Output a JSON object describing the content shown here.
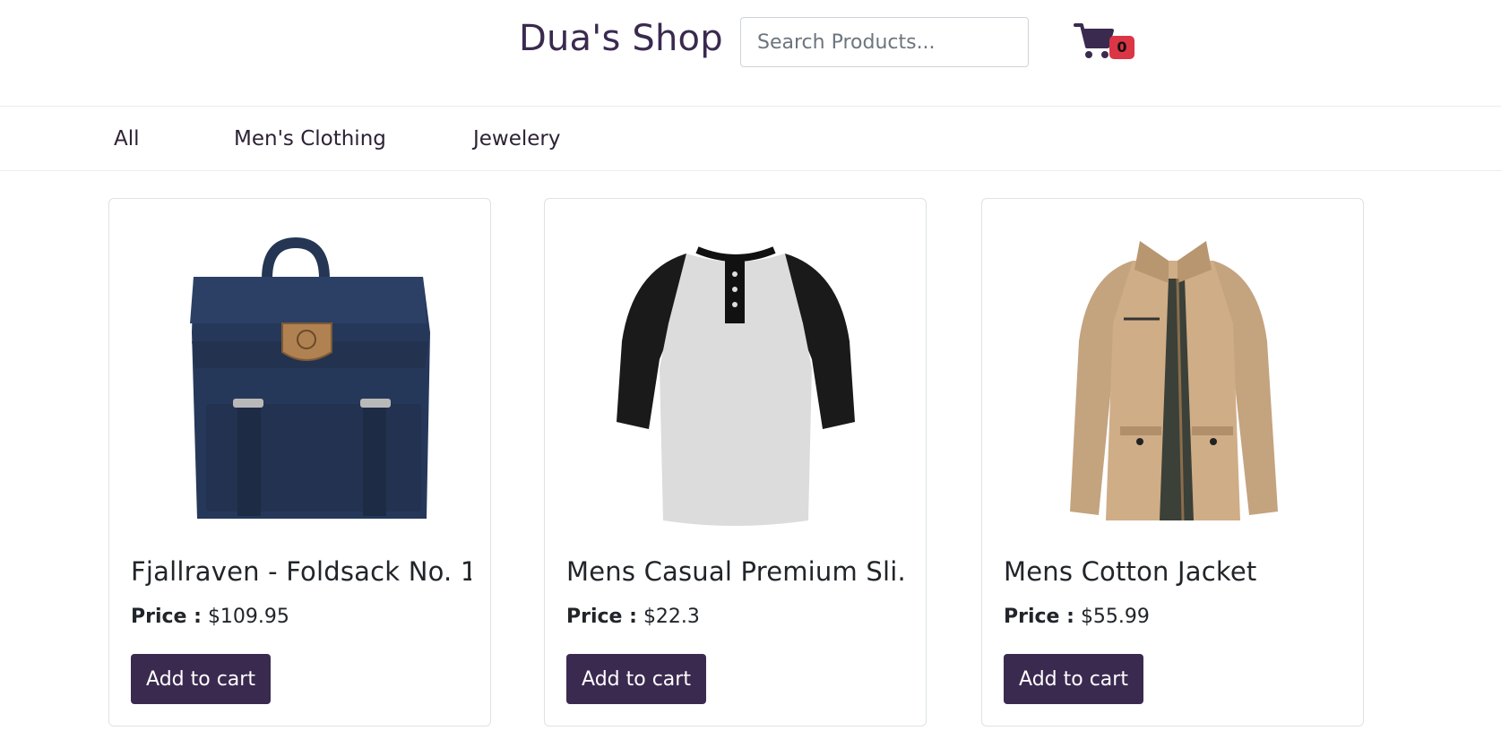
{
  "header": {
    "brand": "Dua's Shop",
    "search_placeholder": "Search Products...",
    "cart_icon": "cart-icon",
    "cart_count": "0",
    "cart_badge_color": "#dc3545"
  },
  "nav": {
    "items": [
      {
        "label": "All"
      },
      {
        "label": "Men's Clothing"
      },
      {
        "label": "Jewelery"
      }
    ]
  },
  "products": [
    {
      "title": "Fjallraven - Foldsack No. 1...",
      "price_label": "Price :",
      "price": "$109.95",
      "button_label": "Add to cart",
      "image": "backpack-image"
    },
    {
      "title": "Mens Casual Premium Sli...",
      "price_label": "Price :",
      "price": "$22.3",
      "button_label": "Add to cart",
      "image": "raglan-shirt-image"
    },
    {
      "title": "Mens Cotton Jacket",
      "price_label": "Price :",
      "price": "$55.99",
      "button_label": "Add to cart",
      "image": "jacket-image"
    }
  ],
  "colors": {
    "brand": "#3a2a4f",
    "button": "#3b2a50"
  }
}
